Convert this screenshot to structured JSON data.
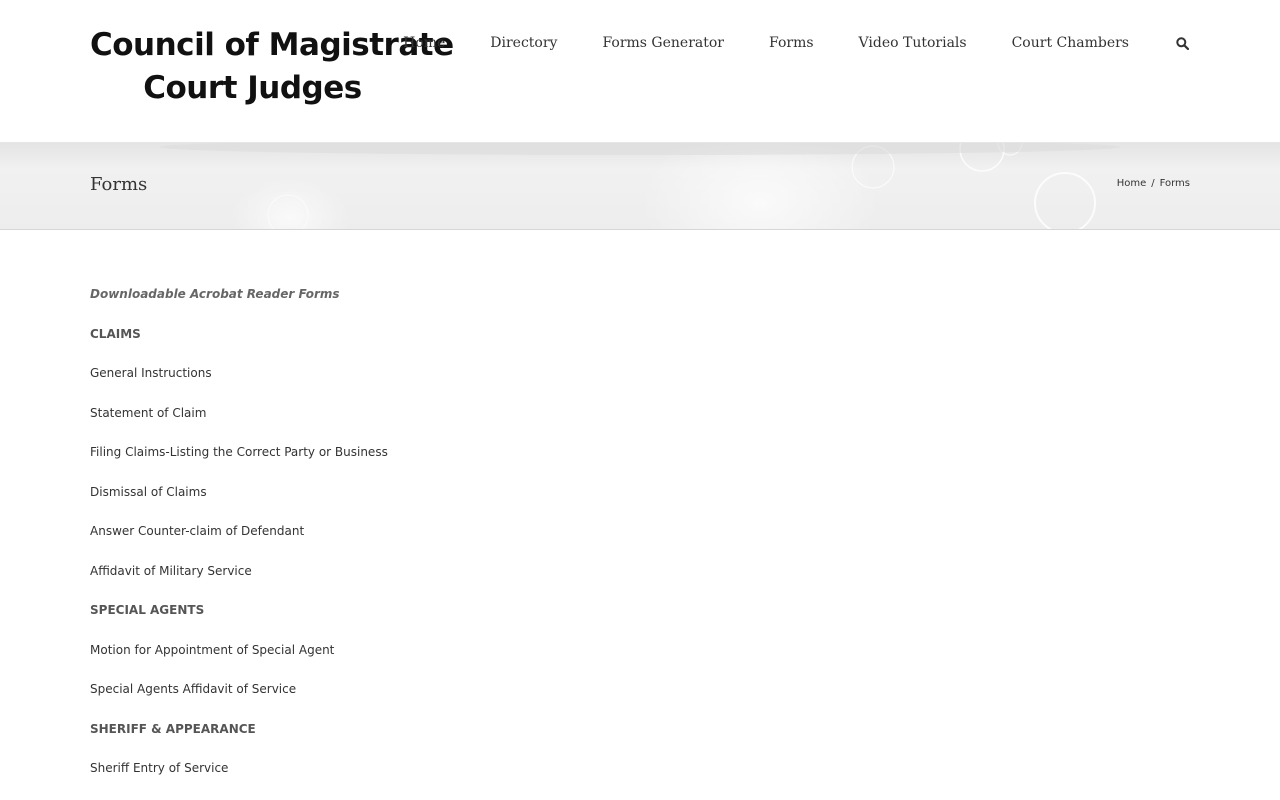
{
  "header": {
    "logo_line1": "Council of Magistrate",
    "logo_line2": "Court Judges",
    "nav": [
      "Home",
      "Directory",
      "Forms Generator",
      "Forms",
      "Video Tutorials",
      "Court Chambers"
    ],
    "search_icon": "search-icon"
  },
  "title_bar": {
    "title": "Forms",
    "breadcrumb": {
      "home": "Home",
      "separator": "/",
      "current": "Forms"
    }
  },
  "content": {
    "intro": "Downloadable Acrobat Reader Forms",
    "sections": [
      {
        "heading": "CLAIMS",
        "links": [
          "General Instructions",
          "Statement of Claim",
          "Filing Claims-Listing the Correct Party or Business",
          "Dismissal of Claims",
          "Answer Counter-claim of Defendant",
          "Affidavit of Military Service"
        ]
      },
      {
        "heading": "SPECIAL AGENTS",
        "links": [
          "Motion for Appointment of Special Agent",
          "Special Agents Affidavit of Service"
        ]
      },
      {
        "heading": "SHERIFF & APPEARANCE",
        "links": [
          "Sheriff Entry of Service"
        ]
      }
    ]
  },
  "colors": {
    "text": "#333333",
    "heading": "#555555",
    "intro": "#666666",
    "title_bar_bg": "#ededed"
  }
}
